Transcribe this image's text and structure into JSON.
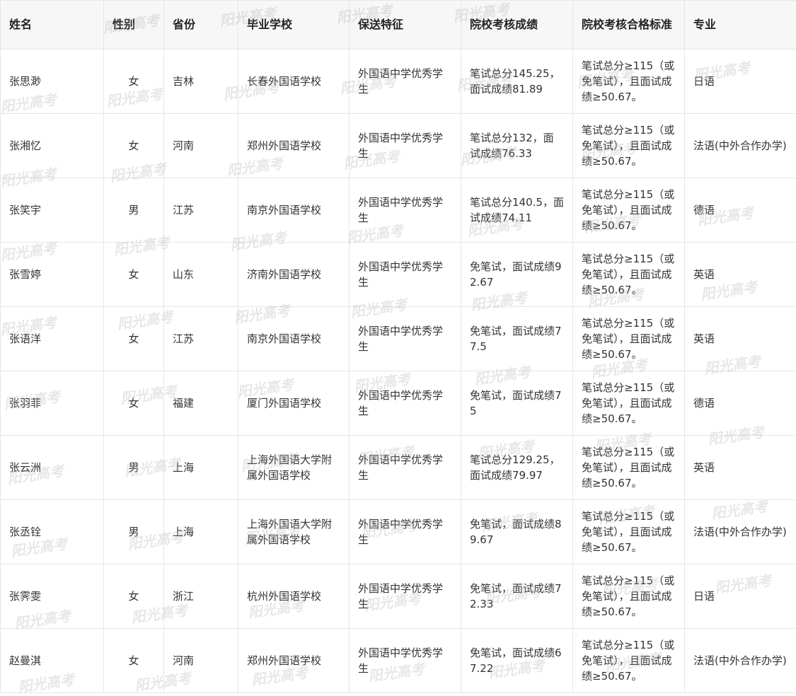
{
  "watermark_text": "阳光高考",
  "table": {
    "headers": [
      "姓名",
      "性别",
      "省份",
      "毕业学校",
      "保送特征",
      "院校考核成绩",
      "院校考核合格标准",
      "专业"
    ],
    "rows": [
      [
        "张思渺",
        "女",
        "吉林",
        "长春外国语学校",
        "外国语中学优秀学生",
        "笔试总分145.25，面试成绩81.89",
        "笔试总分≥115（或免笔试），且面试成绩≥50.67。",
        "日语"
      ],
      [
        "张湘忆",
        "女",
        "河南",
        "郑州外国语学校",
        "外国语中学优秀学生",
        "笔试总分132，面试成绩76.33",
        "笔试总分≥115（或免笔试），且面试成绩≥50.67。",
        "法语(中外合作办学)"
      ],
      [
        "张笑宇",
        "男",
        "江苏",
        "南京外国语学校",
        "外国语中学优秀学生",
        "笔试总分140.5，面试成绩74.11",
        "笔试总分≥115（或免笔试），且面试成绩≥50.67。",
        "德语"
      ],
      [
        "张雪婷",
        "女",
        "山东",
        "济南外国语学校",
        "外国语中学优秀学生",
        "免笔试，面试成绩92.67",
        "笔试总分≥115（或免笔试），且面试成绩≥50.67。",
        "英语"
      ],
      [
        "张语洋",
        "女",
        "江苏",
        "南京外国语学校",
        "外国语中学优秀学生",
        "免笔试，面试成绩77.5",
        "笔试总分≥115（或免笔试），且面试成绩≥50.67。",
        "英语"
      ],
      [
        "张羽菲",
        "女",
        "福建",
        "厦门外国语学校",
        "外国语中学优秀学生",
        "免笔试，面试成绩75",
        "笔试总分≥115（或免笔试），且面试成绩≥50.67。",
        "德语"
      ],
      [
        "张云洲",
        "男",
        "上海",
        "上海外国语大学附属外国语学校",
        "外国语中学优秀学生",
        "笔试总分129.25，面试成绩79.97",
        "笔试总分≥115（或免笔试），且面试成绩≥50.67。",
        "英语"
      ],
      [
        "张丞铨",
        "男",
        "上海",
        "上海外国语大学附属外国语学校",
        "外国语中学优秀学生",
        "免笔试，面试成绩89.67",
        "笔试总分≥115（或免笔试），且面试成绩≥50.67。",
        "法语(中外合作办学)"
      ],
      [
        "张霁雯",
        "女",
        "浙江",
        "杭州外国语学校",
        "外国语中学优秀学生",
        "免笔试，面试成绩72.33",
        "笔试总分≥115（或免笔试），且面试成绩≥50.67。",
        "日语"
      ],
      [
        "赵曼淇",
        "女",
        "河南",
        "郑州外国语学校",
        "外国语中学优秀学生",
        "免笔试，面试成绩67.22",
        "笔试总分≥115（或免笔试），且面试成绩≥50.67。",
        "法语(中外合作办学)"
      ]
    ]
  }
}
